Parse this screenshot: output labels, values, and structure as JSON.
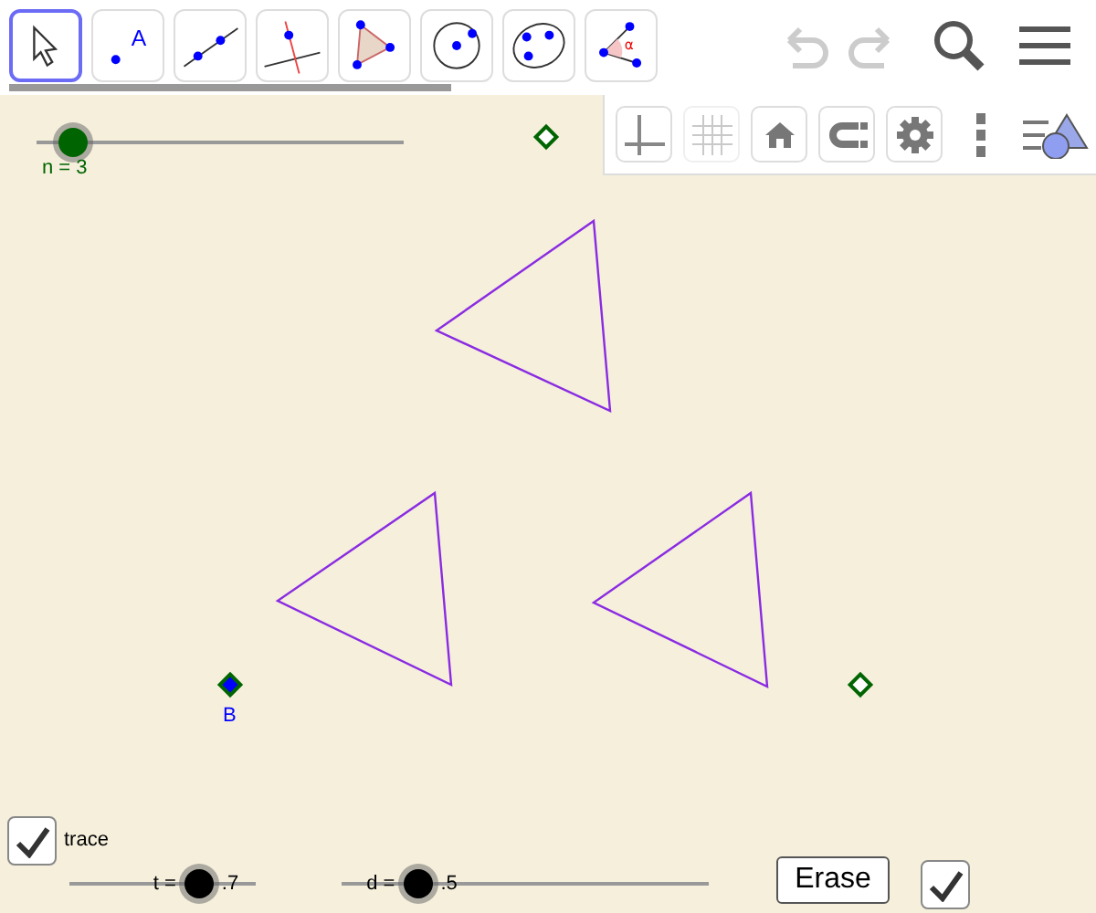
{
  "toolbar": {
    "tools": [
      {
        "kind": "move",
        "selected": true
      },
      {
        "kind": "point",
        "glyph": "A",
        "selected": false
      },
      {
        "kind": "line",
        "selected": false
      },
      {
        "kind": "perpendicular",
        "selected": false
      },
      {
        "kind": "polygon",
        "selected": false
      },
      {
        "kind": "circle",
        "selected": false
      },
      {
        "kind": "conic",
        "selected": false
      },
      {
        "kind": "angle",
        "glyph": "α",
        "selected": false
      }
    ],
    "undo_disabled": true,
    "redo_disabled": true
  },
  "style_bar": {
    "buttons": [
      {
        "kind": "axes",
        "on": true
      },
      {
        "kind": "grid",
        "on": false
      },
      {
        "kind": "home",
        "on": true
      },
      {
        "kind": "magnet",
        "on": true
      },
      {
        "kind": "gear",
        "on": true
      }
    ]
  },
  "canvas": {
    "sliders": [
      {
        "label": "n = 3",
        "level": 0.1,
        "color": "#006400"
      },
      {
        "label_left": "t =",
        "label_right": ".7",
        "level": 0.7,
        "color": "#000000"
      },
      {
        "label_left": "d =",
        "label_right": ".5",
        "level": 0.21,
        "color": "#000000"
      }
    ],
    "points": [
      {
        "label": "B",
        "color": "#0000ff"
      }
    ],
    "trace_checkbox": {
      "label": "trace",
      "checked": true
    },
    "erase_button": "Erase",
    "second_checkbox": {
      "checked": true
    }
  }
}
